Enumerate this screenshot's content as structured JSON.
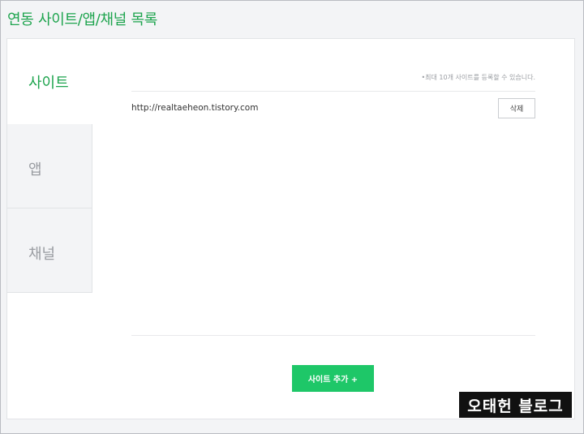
{
  "page": {
    "title": "연동 사이트/앱/채널 목록"
  },
  "tabs": [
    {
      "label": "사이트",
      "active": true
    },
    {
      "label": "앱",
      "active": false
    },
    {
      "label": "채널",
      "active": false
    }
  ],
  "content": {
    "hint": "•최대 10개 사이트를 등록할 수 있습니다.",
    "sites": [
      {
        "url": "http://realtaeheon.tistory.com",
        "delete_label": "삭제"
      }
    ],
    "add_button_label": "사이트 추가 +"
  },
  "watermark": "오태헌 블로그",
  "colors": {
    "accent": "#1ea44e",
    "button": "#1ec768"
  }
}
